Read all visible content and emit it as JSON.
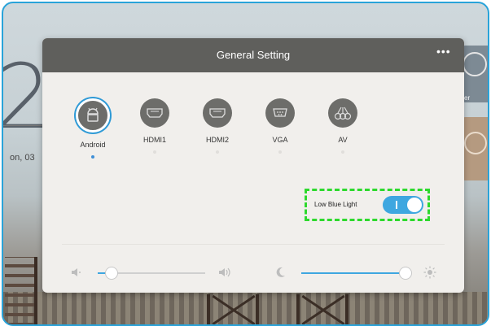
{
  "background": {
    "clock_digit": "2",
    "date_text": "on, 03",
    "tile_label": "er"
  },
  "dialog": {
    "title": "General Setting",
    "more_icon": "more-dots-icon"
  },
  "sources": [
    {
      "label": "Android",
      "icon": "android-icon",
      "selected": true
    },
    {
      "label": "HDMI1",
      "icon": "hdmi-icon",
      "selected": false
    },
    {
      "label": "HDMI2",
      "icon": "hdmi-icon",
      "selected": false
    },
    {
      "label": "VGA",
      "icon": "vga-icon",
      "selected": false
    },
    {
      "label": "AV",
      "icon": "av-icon",
      "selected": false
    }
  ],
  "low_blue_light": {
    "label": "Low Blue Light",
    "enabled": true
  },
  "volume": {
    "level": 0.12,
    "min_icon": "speaker-low-icon",
    "max_icon": "speaker-high-icon"
  },
  "brightness": {
    "level": 0.98,
    "min_icon": "moon-icon",
    "max_icon": "sun-icon"
  },
  "colors": {
    "accent": "#3ea7e0",
    "header": "#5f5f5c",
    "highlight": "#2dd92d",
    "frame_border": "#29a3d9"
  }
}
